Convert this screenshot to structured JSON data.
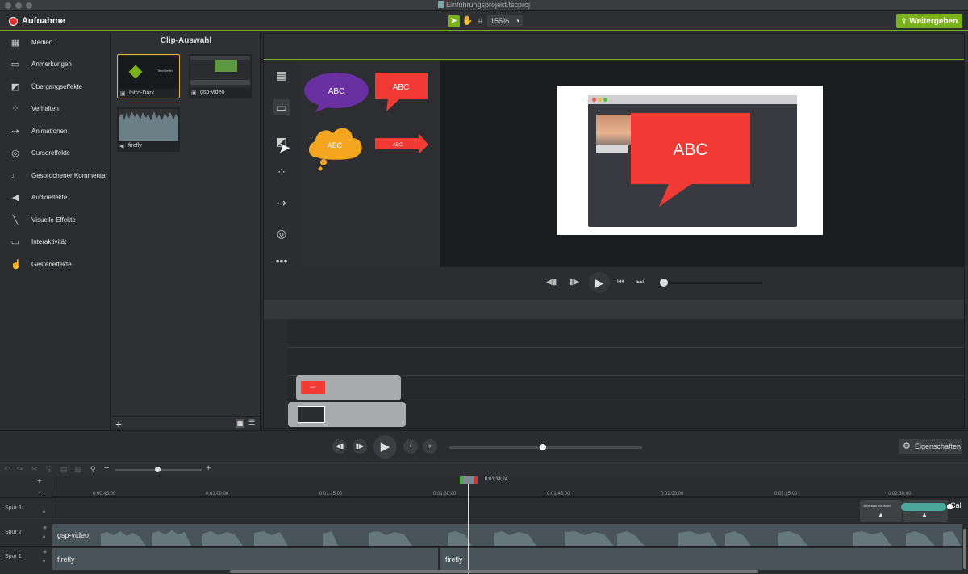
{
  "window": {
    "title": "Einführungsprojekt.tscproj"
  },
  "toolbar": {
    "record_label": "Aufnahme",
    "zoom": "155%",
    "share_label": "Weitergeben"
  },
  "sidebar": {
    "items": [
      {
        "label": "Medien",
        "icon": "film-icon"
      },
      {
        "label": "Anmerkungen",
        "icon": "callout-icon"
      },
      {
        "label": "Übergangseffekte",
        "icon": "transition-icon"
      },
      {
        "label": "Verhalten",
        "icon": "behavior-icon"
      },
      {
        "label": "Animationen",
        "icon": "animation-icon"
      },
      {
        "label": "Cursoreffekte",
        "icon": "cursor-icon"
      },
      {
        "label": "Gesprochener Kommentar",
        "icon": "microphone-icon"
      },
      {
        "label": "Audioeffekte",
        "icon": "speaker-icon"
      },
      {
        "label": "Visuelle Effekte",
        "icon": "wand-icon"
      },
      {
        "label": "Interaktivität",
        "icon": "interactivity-icon"
      },
      {
        "label": "Gesteneffekte",
        "icon": "hand-icon"
      }
    ]
  },
  "clip_bin": {
    "title": "Clip-Auswahl",
    "clips": [
      {
        "label": "Intro-Dark",
        "kind": "video"
      },
      {
        "label": "gsp-video",
        "kind": "video"
      },
      {
        "label": "firefly",
        "kind": "audio"
      }
    ],
    "intro_thumb_text": "TechSmith"
  },
  "asset_gallery": {
    "shapes": [
      {
        "label": "ABC",
        "color": "#6a2fa0"
      },
      {
        "label": "ABC",
        "color": "#f03a33"
      },
      {
        "label": "ABC",
        "color": "#f3a51d"
      },
      {
        "label": "ABC",
        "color": "#f03a33"
      }
    ]
  },
  "canvas": {
    "callout_text": "ABC",
    "callout_color": "#f03a33"
  },
  "preview_clips": {
    "callout_text": "ABC"
  },
  "transport": {
    "properties_label": "Eigenschaften"
  },
  "timeline": {
    "playhead_time": "0:01:34;24",
    "ticks": [
      "0:00:45;00",
      "0:01:00;00",
      "0:01:15;00",
      "0:01:30;00",
      "0:01:45;00",
      "0:02:00;00",
      "0:02:15;00",
      "0:02:30;00"
    ],
    "tracks": [
      {
        "name": "Spur 3"
      },
      {
        "name": "Spur 2"
      },
      {
        "name": "Spur 1"
      }
    ],
    "track3_clip_text": "Jetzt sind Sie dran!",
    "track3_end_label": "Cal",
    "track2_clip": "gsp-video",
    "track1_clips": [
      "firefly",
      "firefly"
    ]
  },
  "colors": {
    "accent": "#7ab317",
    "record": "#e03030"
  }
}
